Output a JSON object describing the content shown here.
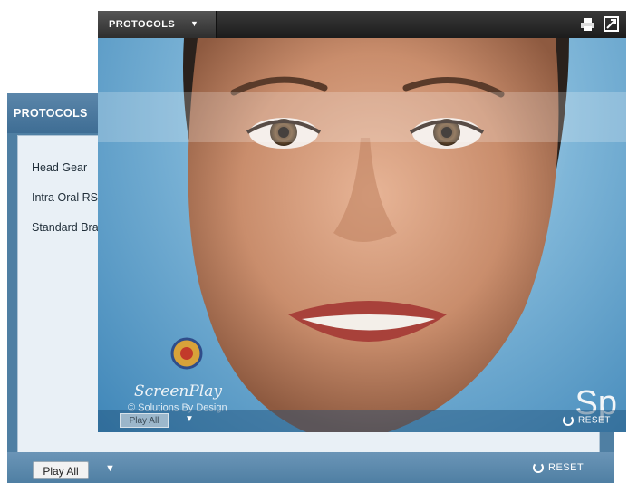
{
  "back_window": {
    "title": "PROTOCOLS",
    "protocols": [
      "Head Gear",
      "Intra Oral RS Procedure",
      "Standard Braces Procedure"
    ],
    "play_all_label": "Play All",
    "reset_label": "RESET"
  },
  "front_window": {
    "title": "PROTOCOLS",
    "play_all_label": "Play All",
    "reset_label": "RESET",
    "copyright": "© Solutions By Design",
    "logo_script": "ScreenPlay",
    "corner_text": "Sp",
    "icons": [
      "print-icon",
      "fullscreen-icon",
      "chevron-down-icon"
    ]
  },
  "colors": {
    "back_chrome": "#4f7fa3",
    "front_titlebar": "#1c1c1c",
    "stage_blue": "#7fb6d8"
  }
}
